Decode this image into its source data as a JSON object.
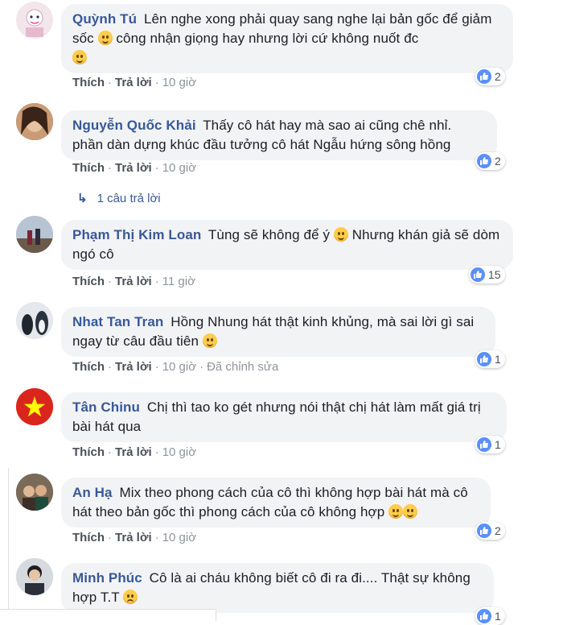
{
  "comments": [
    {
      "author": "Quỳnh Tú",
      "text": "Lên nghe xong phải quay sang nghe lại bản gốc để giảm sốc",
      "text2": "công nhận giọng hay nhưng lời cứ không nuốt đc",
      "like": "Thích",
      "reply": "Trả lời",
      "time": "10 giờ",
      "reactions": "2"
    },
    {
      "author": "Nguyễn Quốc Khải",
      "text": "Thấy cô hát hay mà sao ai cũng chê nhỉ. phần dàn dựng khúc đầu tưởng cô hát Ngẫu hứng sông hồng",
      "like": "Thích",
      "reply": "Trả lời",
      "time": "10 giờ",
      "reactions": "2",
      "replies_label": "1 câu trả lời"
    },
    {
      "author": "Phạm Thị Kim Loan",
      "text": "Tùng sẽ không để ý",
      "text2": "Nhưng khán giả sẽ dòm ngó cô",
      "like": "Thích",
      "reply": "Trả lời",
      "time": "11 giờ",
      "reactions": "15"
    },
    {
      "author": "Nhat Tan Tran",
      "text": "Hồng Nhung hát thật kinh khủng, mà sai lời gì sai ngay từ câu đầu tiên",
      "like": "Thích",
      "reply": "Trả lời",
      "time": "10 giờ",
      "edited": "Đã chỉnh sửa",
      "reactions": "1"
    },
    {
      "author": "Tân Chinu",
      "text": "Chị thì tao ko gét nhưng nói thật chị hát làm mất giá trị bài hát qua",
      "like": "Thích",
      "reply": "Trả lời",
      "time": "10 giờ",
      "reactions": "1"
    },
    {
      "author": "An Hạ",
      "text": "Mix theo phong cách của cô thì không hợp bài hát mà cô hát theo bản gốc thì phong cách của cô không hợp",
      "like": "Thích",
      "reply": "Trả lời",
      "time": "10 giờ",
      "reactions": "2"
    },
    {
      "author": "Minh Phúc",
      "text": "Cô là ai cháu không biết cô đi ra đi.... Thật sự không hợp T.T",
      "reactions": "1"
    }
  ],
  "colors": {
    "author": "#385898",
    "bubble": "#f2f3f5",
    "like_blue": "#5890ff"
  }
}
